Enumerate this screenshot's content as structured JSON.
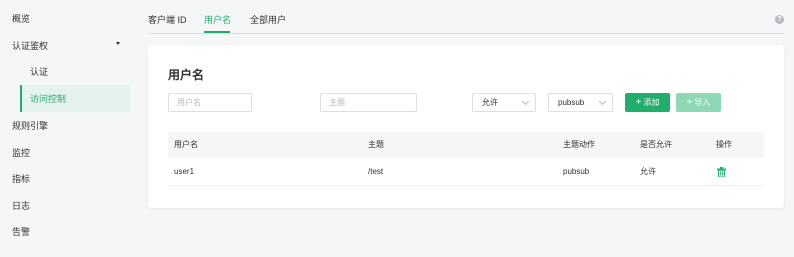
{
  "sidebar": {
    "items": [
      {
        "label": "概览"
      },
      {
        "label": "认证鉴权"
      },
      {
        "label": "认证"
      },
      {
        "label": "访问控制"
      },
      {
        "label": "规则引擎"
      },
      {
        "label": "监控"
      },
      {
        "label": "指标"
      },
      {
        "label": "日志"
      },
      {
        "label": "告警"
      }
    ]
  },
  "tabs": [
    {
      "label": "客户端 ID"
    },
    {
      "label": "用户名"
    },
    {
      "label": "全部用户"
    }
  ],
  "help_icon": "question-circle-icon",
  "card": {
    "title": "用户名",
    "filters": {
      "username_placeholder": "用户名",
      "topic_placeholder": "主题",
      "permission_value": "允许",
      "action_value": "pubsub"
    },
    "add_label": "添加",
    "import_label": "导入",
    "table": {
      "columns": [
        "用户名",
        "主题",
        "主题动作",
        "是否允许",
        "操作"
      ],
      "rows": [
        {
          "username": "user1",
          "topic": "/test",
          "action": "pubsub",
          "permission": "允许",
          "op_icon": "trash-icon"
        }
      ]
    }
  },
  "colors": {
    "accent": "#1fae6b",
    "accent_light": "#8fd7b5",
    "active_bg": "#e6f2ec"
  }
}
